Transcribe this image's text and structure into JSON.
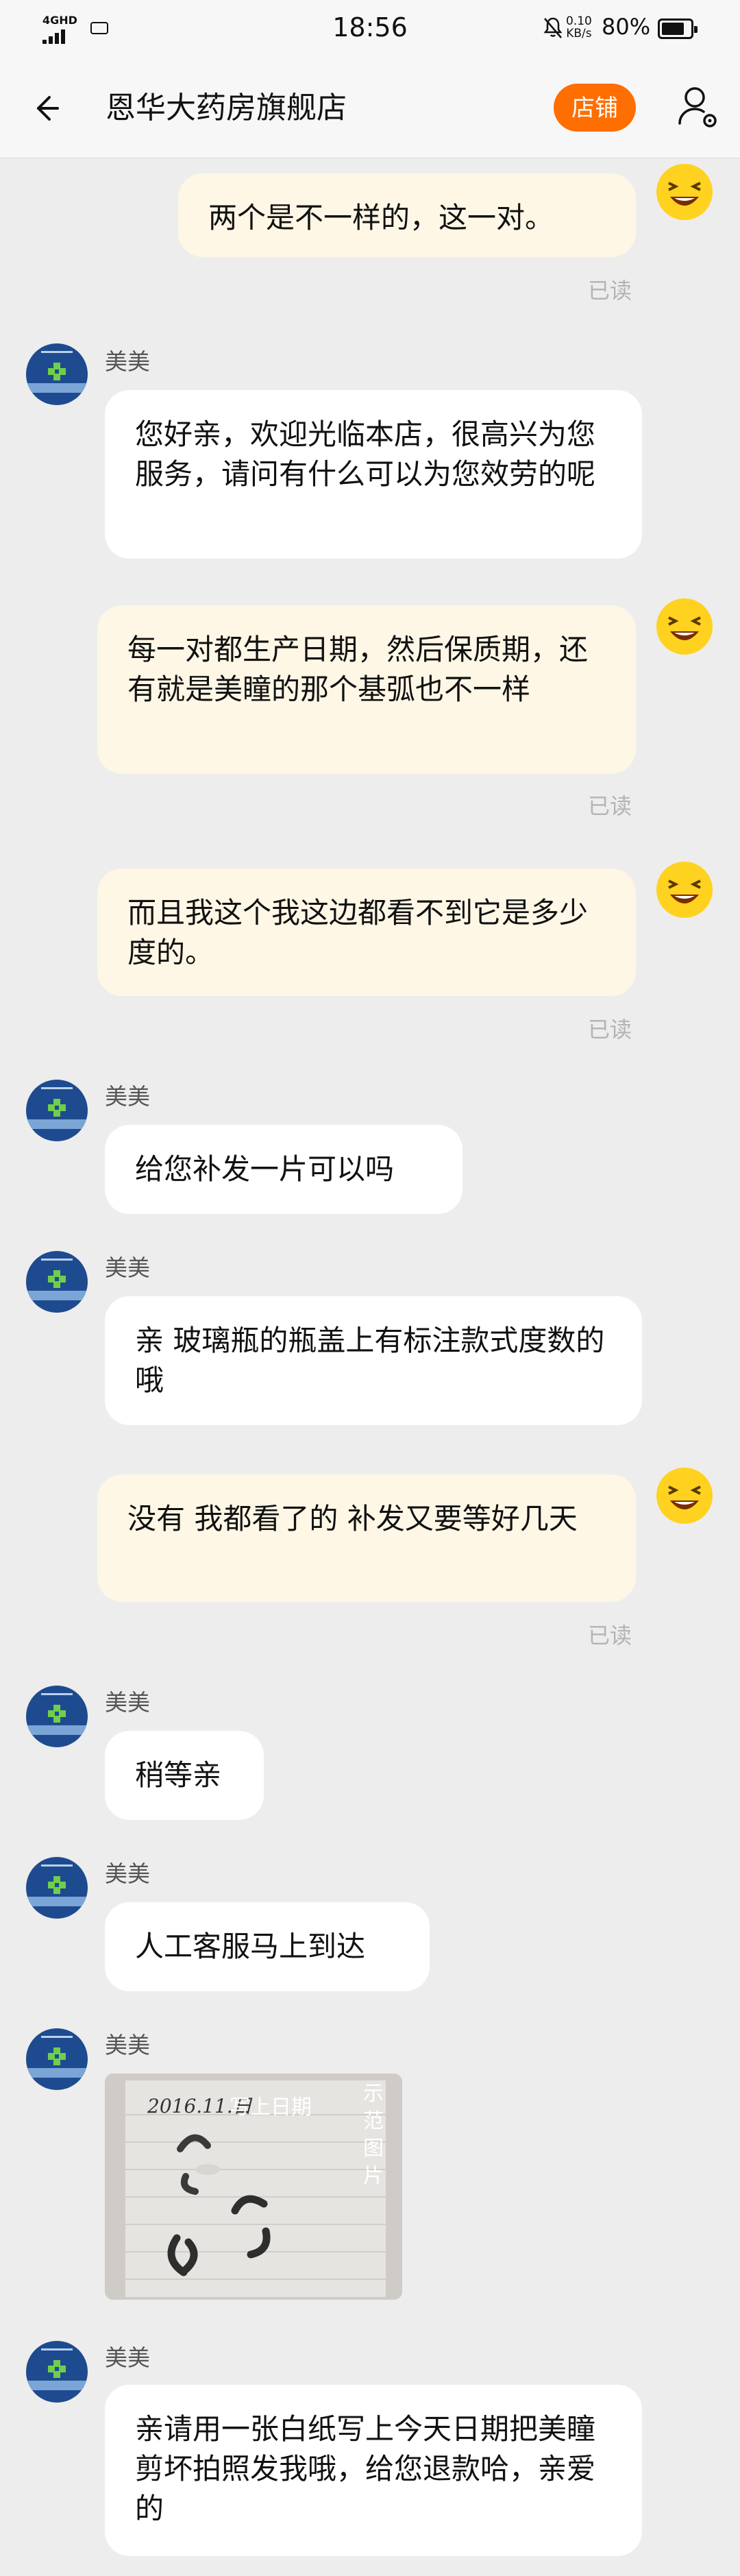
{
  "status_bar": {
    "network": "4GHD",
    "time": "18:56",
    "speed_value": "0.10",
    "speed_unit": "KB/s",
    "battery_percent": "80%",
    "battery_level": 0.8
  },
  "header": {
    "title": "恩华大药房旗舰店",
    "shop_button": "店铺",
    "accent_color": "#ff6e00"
  },
  "messages": [
    {
      "id": "m1",
      "dir": "out",
      "text": "两个是不一样的，这一对。",
      "read": "已读"
    },
    {
      "id": "m2",
      "dir": "in",
      "sender": "美美",
      "text": "您好亲，欢迎光临本店，很高兴为您服务，请问有什么可以为您效劳的呢"
    },
    {
      "id": "m3",
      "dir": "out",
      "text": "每一对都生产日期，然后保质期，还有就是美瞳的那个基弧也不一样",
      "read": "已读"
    },
    {
      "id": "m4",
      "dir": "out",
      "text": "而且我这个我这边都看不到它是多少度的。",
      "read": "已读"
    },
    {
      "id": "m5",
      "dir": "in",
      "sender": "美美",
      "text": "给您补发一片可以吗"
    },
    {
      "id": "m6",
      "dir": "in",
      "sender": "美美",
      "text": "亲 玻璃瓶的瓶盖上有标注款式度数的哦"
    },
    {
      "id": "m7",
      "dir": "out",
      "text": "没有 我都看了的 补发又要等好几天",
      "read": "已读"
    },
    {
      "id": "m8",
      "dir": "in",
      "sender": "美美",
      "text": "稍等亲"
    },
    {
      "id": "m9",
      "dir": "in",
      "sender": "美美",
      "text": "人工客服马上到达"
    },
    {
      "id": "m10",
      "dir": "in",
      "sender": "美美",
      "type": "image",
      "image": {
        "handwriting": "2016.11.日",
        "overlay": "写上日期",
        "vertical_label": "示范图片"
      }
    },
    {
      "id": "m11",
      "dir": "in",
      "sender": "美美",
      "text": "亲请用一张白纸写上今天日期把美瞳剪坏拍照发我哦，给您退款哈，亲爱的"
    }
  ],
  "colors": {
    "background": "#ededed",
    "outgoing_bubble": "#fff7e6",
    "incoming_bubble": "#ffffff",
    "read_text": "#b3b3b3",
    "shop_avatar": "#1e4b8f"
  },
  "icons": {
    "back": "back-arrow-icon",
    "profile": "user-settings-icon",
    "self_avatar": "laughing-emoji-icon",
    "shop_avatar": "pharmacy-cross-logo"
  }
}
